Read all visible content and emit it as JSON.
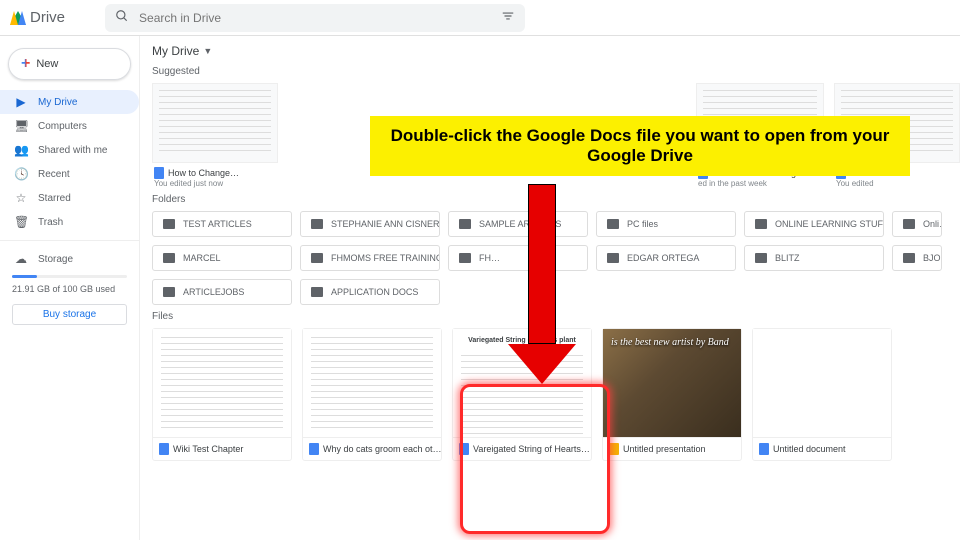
{
  "header": {
    "brand": "Drive",
    "search_placeholder": "Search in Drive"
  },
  "sidebar": {
    "new_label": "New",
    "items": [
      {
        "label": "My Drive"
      },
      {
        "label": "Computers"
      },
      {
        "label": "Shared with me"
      },
      {
        "label": "Recent"
      },
      {
        "label": "Starred"
      },
      {
        "label": "Trash"
      }
    ],
    "storage_item": "Storage",
    "storage_used": "21.91 GB of 100 GB used",
    "buy": "Buy storage"
  },
  "main": {
    "crumb": "My Drive",
    "suggested_label": "Suggested",
    "suggested": [
      {
        "title": "How to Change…",
        "sub": "You edited just now"
      },
      {
        "title": "",
        "sub": ""
      },
      {
        "title": "",
        "sub": ""
      },
      {
        "title": "",
        "sub": ""
      },
      {
        "title": "w to Pause an Instagram …",
        "sub": "ed in the past week"
      },
      {
        "title": "How t…",
        "sub": "You edited"
      }
    ],
    "folders_label": "Folders",
    "folders": [
      "TEST ARTICLES",
      "STEPHANIE ANN CISNERO…",
      "SAMPLE ARTICLES",
      "PC files",
      "ONLINE LEARNING STUFF",
      "Onli…",
      "MARCEL",
      "FHMOMS FREE TRAINING …",
      "FH…",
      "EDGAR ORTEGA",
      "BLITZ",
      "BJO…",
      "ARTICLEJOBS",
      "APPLICATION DOCS"
    ],
    "files_label": "Files",
    "files": [
      {
        "title": "Wiki Test Chapter",
        "type": "doc"
      },
      {
        "title": "Why do cats groom each ot…",
        "type": "doc"
      },
      {
        "title": "Vareigated String of Hearts…",
        "type": "doc",
        "thumb_title": "Variegated String of hearts plant care"
      },
      {
        "title": "Untitled presentation",
        "type": "slides",
        "thumb_title": "is the best new artist by Band"
      },
      {
        "title": "Untitled document",
        "type": "doc"
      }
    ]
  },
  "callout": "Double-click the Google Docs file you want to open from your Google Drive"
}
